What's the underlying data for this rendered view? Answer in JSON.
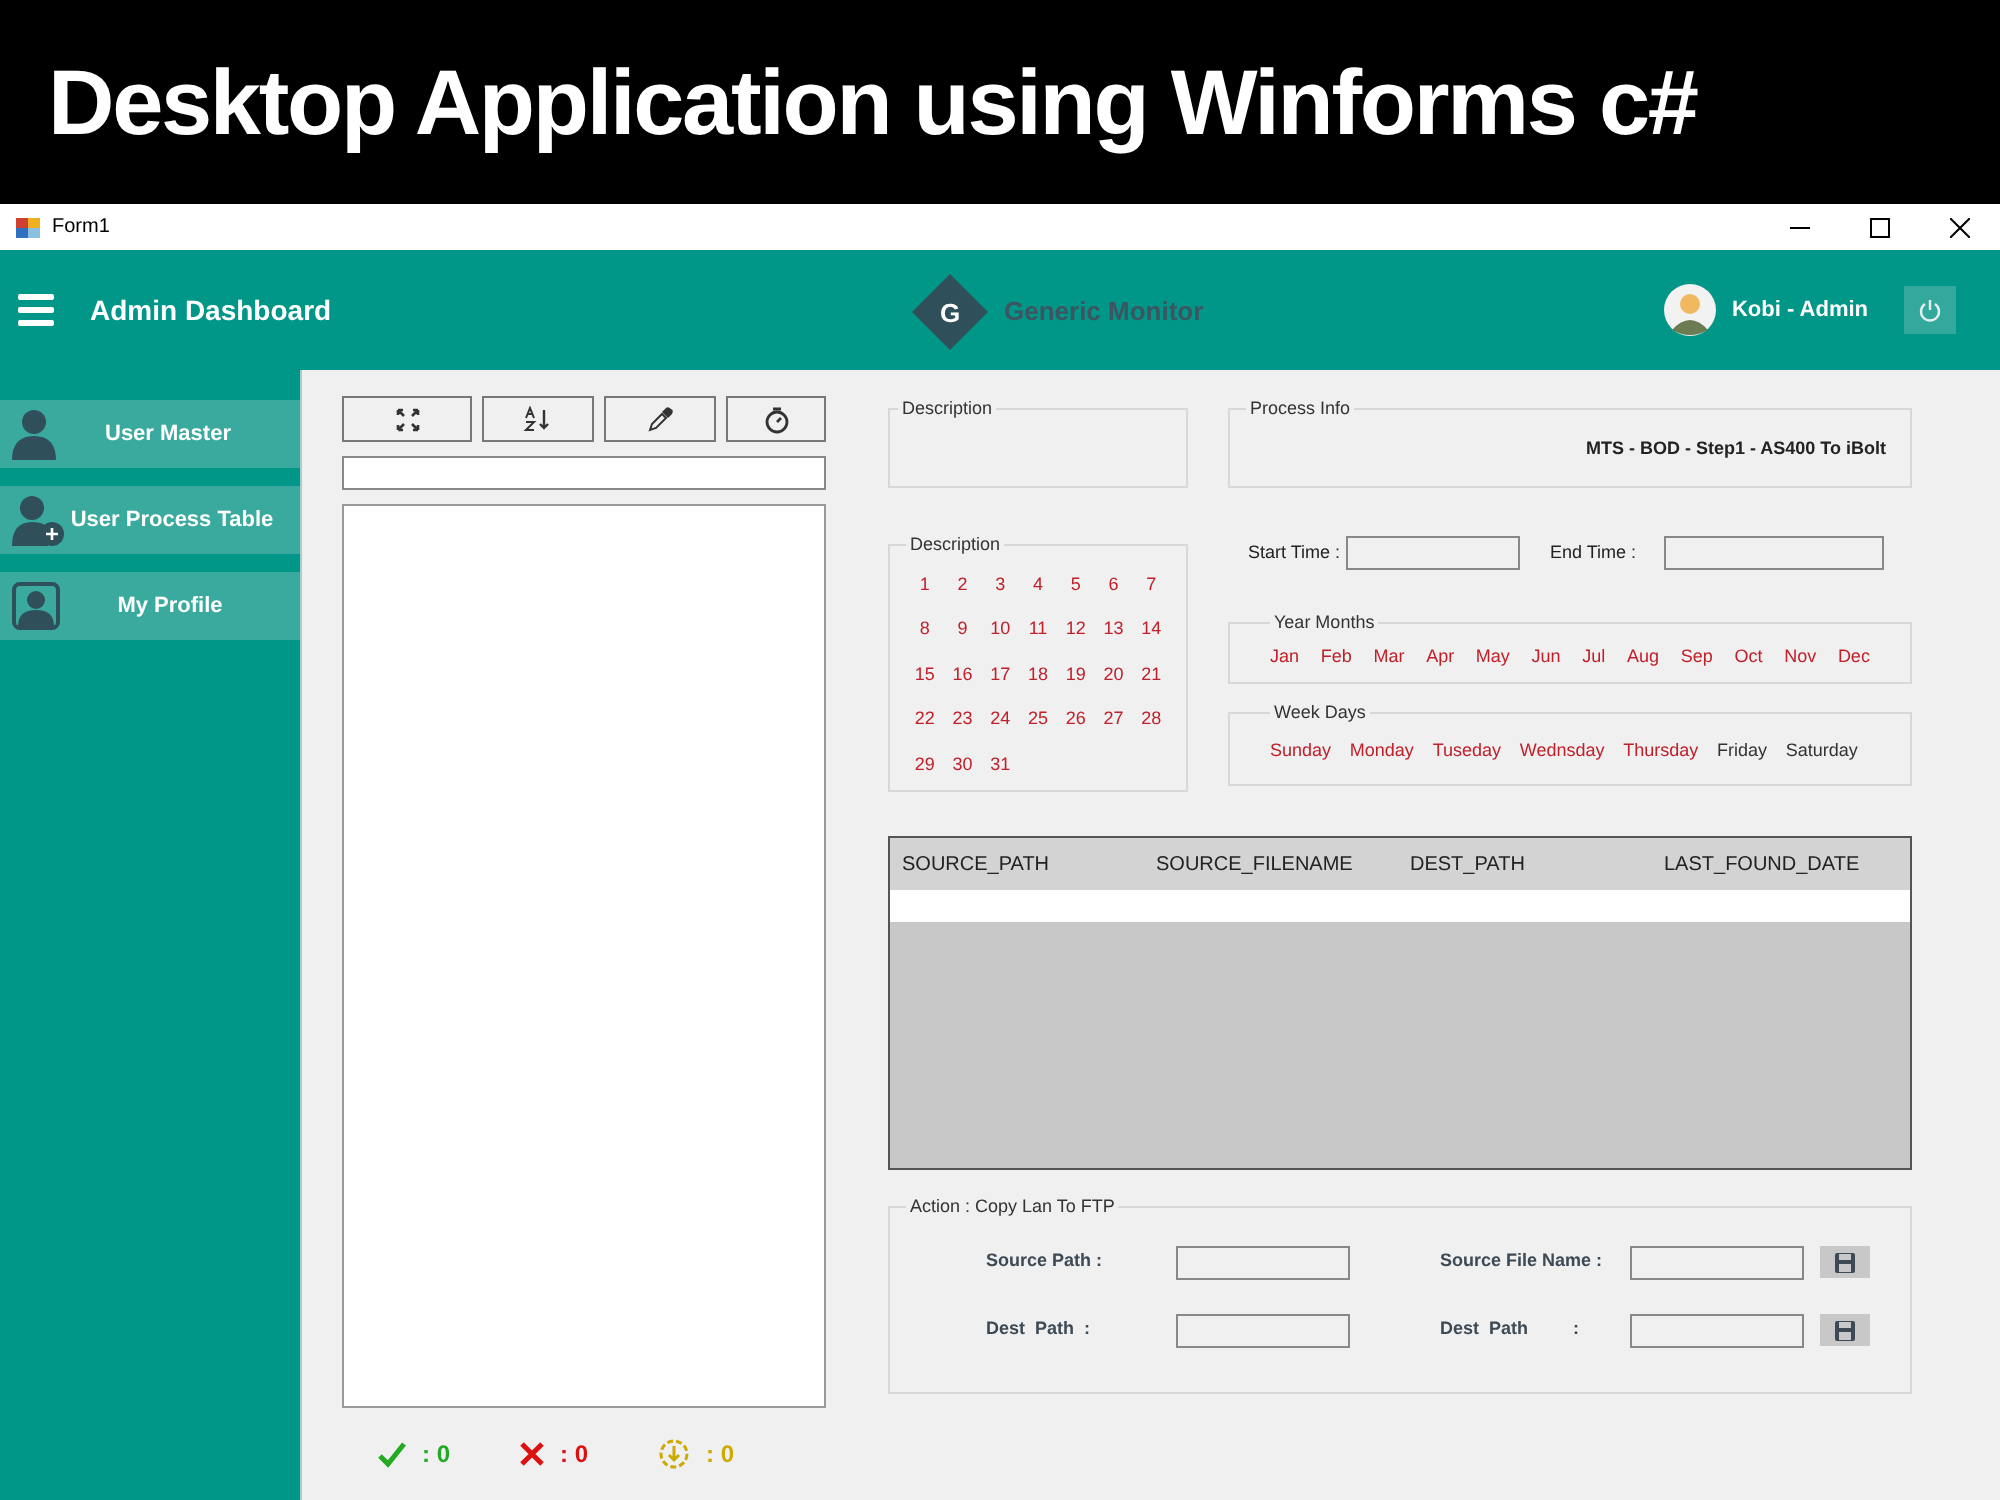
{
  "banner": {
    "title": "Desktop Application using Winforms c#"
  },
  "window": {
    "title": "Form1"
  },
  "header": {
    "title": "Admin Dashboard",
    "logo_letter": "G",
    "app_name": "Generic Monitor",
    "user": "Kobi - Admin"
  },
  "sidebar": {
    "items": [
      {
        "label": "User Master",
        "kind": "user"
      },
      {
        "label": "User Process Table",
        "kind": "user-add"
      },
      {
        "label": "My Profile",
        "kind": "profile"
      }
    ]
  },
  "toolbar": {
    "buttons": [
      {
        "kind": "expand"
      },
      {
        "kind": "sort"
      },
      {
        "kind": "picker"
      },
      {
        "kind": "timer"
      }
    ]
  },
  "description_group": {
    "title": "Description"
  },
  "process_info": {
    "title": "Process Info",
    "value": "MTS - BOD - Step1 - AS400 To iBolt"
  },
  "calendar": {
    "title": "Description",
    "days": [
      {
        "label": "1",
        "selected": true
      },
      {
        "label": "2",
        "selected": true
      },
      {
        "label": "3",
        "selected": true
      },
      {
        "label": "4",
        "selected": true
      },
      {
        "label": "5",
        "selected": true
      },
      {
        "label": "6",
        "selected": true
      },
      {
        "label": "7",
        "selected": true
      },
      {
        "label": "8",
        "selected": true
      },
      {
        "label": "9",
        "selected": true
      },
      {
        "label": "10",
        "selected": true
      },
      {
        "label": "11",
        "selected": true
      },
      {
        "label": "12",
        "selected": true
      },
      {
        "label": "13",
        "selected": true
      },
      {
        "label": "14",
        "selected": true
      },
      {
        "label": "15",
        "selected": true
      },
      {
        "label": "16",
        "selected": true
      },
      {
        "label": "17",
        "selected": true
      },
      {
        "label": "18",
        "selected": true
      },
      {
        "label": "19",
        "selected": true
      },
      {
        "label": "20",
        "selected": true
      },
      {
        "label": "21",
        "selected": true
      },
      {
        "label": "22",
        "selected": true
      },
      {
        "label": "23",
        "selected": true
      },
      {
        "label": "24",
        "selected": true
      },
      {
        "label": "25",
        "selected": true
      },
      {
        "label": "26",
        "selected": true
      },
      {
        "label": "27",
        "selected": true
      },
      {
        "label": "28",
        "selected": true
      },
      {
        "label": "29",
        "selected": true
      },
      {
        "label": "30",
        "selected": true
      },
      {
        "label": "31",
        "selected": true
      }
    ]
  },
  "time": {
    "start_label": "Start Time :",
    "end_label": "End Time :"
  },
  "months": {
    "title": "Year Months",
    "items": [
      {
        "label": "Jan",
        "selected": true
      },
      {
        "label": "Feb",
        "selected": true
      },
      {
        "label": "Mar",
        "selected": true
      },
      {
        "label": "Apr",
        "selected": true
      },
      {
        "label": "May",
        "selected": true
      },
      {
        "label": "Jun",
        "selected": true
      },
      {
        "label": "Jul",
        "selected": true
      },
      {
        "label": "Aug",
        "selected": true
      },
      {
        "label": "Sep",
        "selected": true
      },
      {
        "label": "Oct",
        "selected": true
      },
      {
        "label": "Nov",
        "selected": true
      },
      {
        "label": "Dec",
        "selected": true
      }
    ]
  },
  "week_days": {
    "title": "Week Days",
    "items": [
      {
        "label": "Sunday",
        "selected": true
      },
      {
        "label": "Monday",
        "selected": true
      },
      {
        "label": "Tuseday",
        "selected": true
      },
      {
        "label": "Wednsday",
        "selected": true
      },
      {
        "label": "Thursday",
        "selected": true
      },
      {
        "label": "Friday",
        "selected": false
      },
      {
        "label": "Saturday",
        "selected": false
      }
    ]
  },
  "table": {
    "columns": [
      "SOURCE_PATH",
      "SOURCE_FILENAME",
      "DEST_PATH",
      "LAST_FOUND_DATE"
    ]
  },
  "action": {
    "title": "Action : Copy Lan To FTP",
    "fields": [
      {
        "label": "Source Path :",
        "has_save": false
      },
      {
        "label": "Source File Name :",
        "has_save": true
      },
      {
        "label": "Dest  Path  :",
        "has_save": false
      },
      {
        "label": "Dest  Path         :",
        "has_save": true
      }
    ]
  },
  "counters": [
    {
      "kind": "success",
      "value": ": 0",
      "color": "#22aa22"
    },
    {
      "kind": "failed",
      "value": ": 0",
      "color": "#dd1111"
    },
    {
      "kind": "pending",
      "value": ": 0",
      "color": "#ccaa00"
    }
  ]
}
